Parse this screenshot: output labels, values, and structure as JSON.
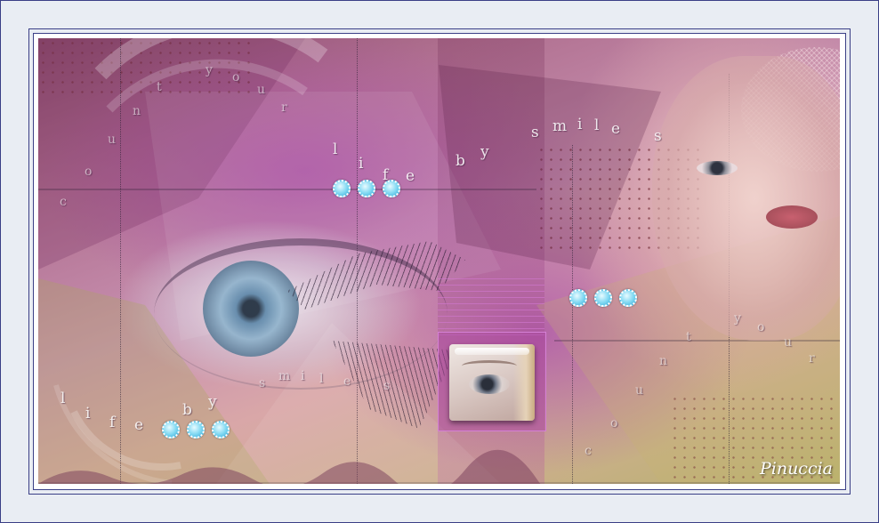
{
  "signature": "Pinuccia",
  "letters": [
    "y",
    "o",
    "u",
    "r",
    "t",
    "n",
    "u",
    "o",
    "c",
    "l",
    "i",
    "f",
    "e",
    "b",
    "y",
    "s",
    "m",
    "i",
    "l",
    "e",
    "s",
    "l",
    "i",
    "f",
    "e",
    "b",
    "y",
    "s",
    "m",
    "i",
    "l",
    "e",
    "s",
    "y",
    "o",
    "u",
    "r",
    "t",
    "n",
    "u",
    "o",
    "c"
  ],
  "colors": {
    "frame_border": "#3a3f86",
    "page_background": "#e9edf3",
    "dot_fill": "#7fd8f2",
    "thumbnail_border": "#d580d5"
  }
}
